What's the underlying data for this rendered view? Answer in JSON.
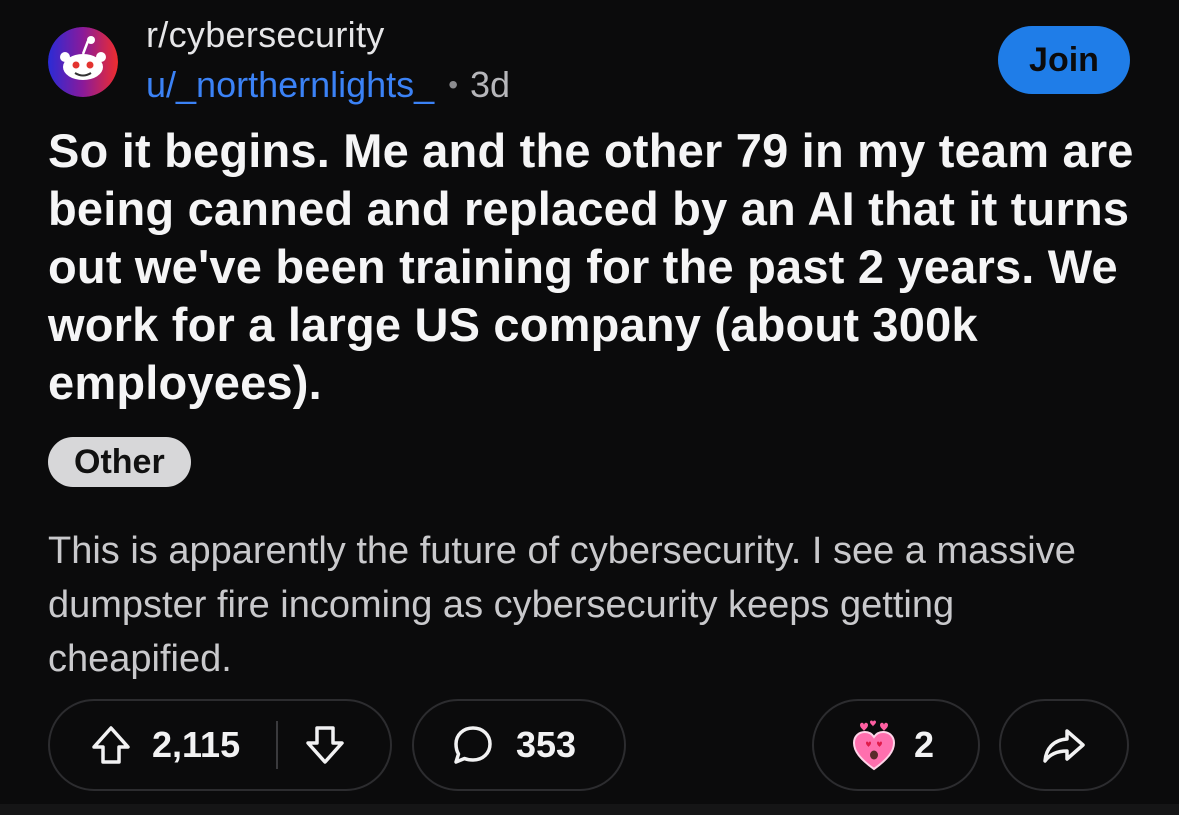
{
  "header": {
    "subreddit": "r/cybersecurity",
    "username": "u/_northernlights_",
    "separator": "•",
    "age": "3d",
    "join_label": "Join"
  },
  "post": {
    "title": "So it begins. Me and the other 79 in my team are being canned and replaced by an AI that it turns out we've been training for the past 2 years. We work for a large US company (about 300k employees).",
    "flair": "Other",
    "body": "This is apparently the future of cybersecurity. I see a massive dumpster fire incoming as cybersecurity keeps getting cheapified."
  },
  "actions": {
    "upvote_icon": "arrow-up-icon",
    "votes": "2,115",
    "downvote_icon": "arrow-down-icon",
    "comment_icon": "speech-bubble-icon",
    "comments": "353",
    "award_icon": "heart-eyes-award-icon",
    "awards": "2",
    "share_icon": "share-arrow-icon"
  },
  "colors": {
    "background": "#0b0b0c",
    "accent": "#1f7de8",
    "username": "#3b82f6",
    "flair_bg": "#d7d7d9",
    "avatar_red": "#ef2d2d",
    "avatar_blue": "#2a2bd6"
  }
}
